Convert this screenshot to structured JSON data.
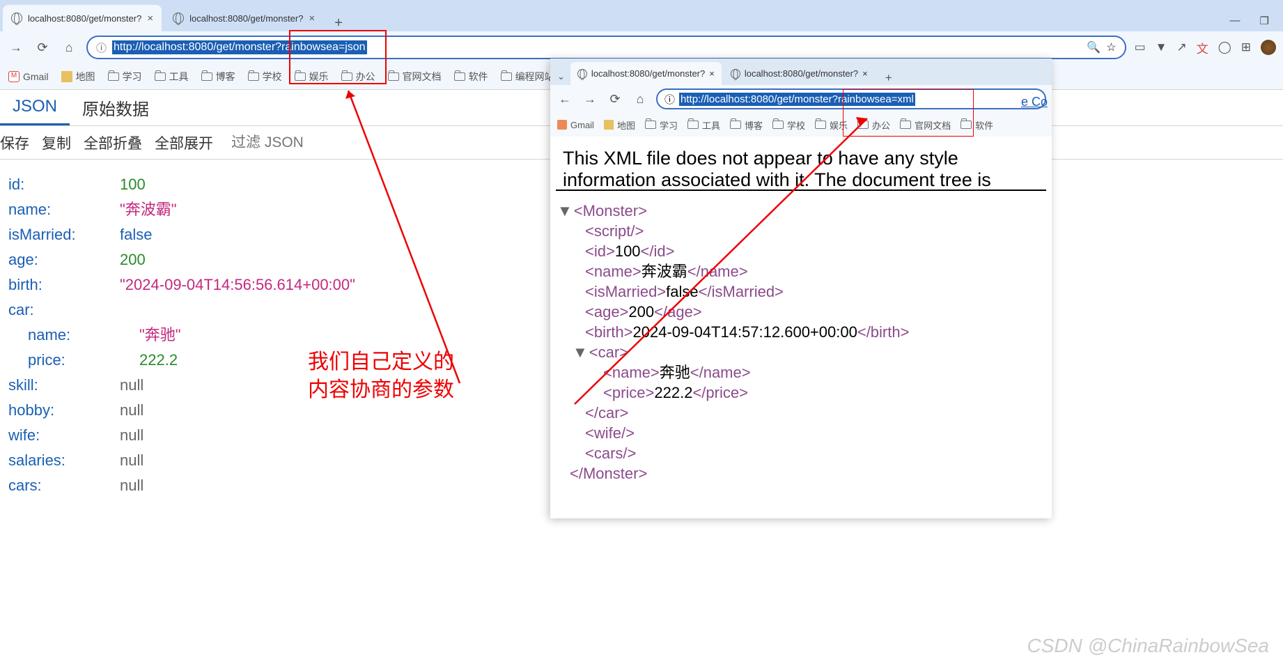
{
  "main_window": {
    "tabs": [
      {
        "title": "localhost:8080/get/monster?"
      },
      {
        "title": "localhost:8080/get/monster?"
      }
    ],
    "url_selected": "http://localhost:8080/get/monster?rainbowsea=json",
    "bookmarks": [
      "Gmail",
      "地图",
      "学习",
      "工具",
      "博客",
      "学校",
      "娱乐",
      "办公",
      "官网文档",
      "软件",
      "编程网站"
    ],
    "json_tab_active": "JSON",
    "json_tab_raw": "原始数据",
    "toolbar": {
      "save": "保存",
      "copy": "复制",
      "collapse": "全部折叠",
      "expand": "全部展开",
      "filter_placeholder": "过滤 JSON"
    },
    "json": {
      "id": "100",
      "name": "\"奔波霸\"",
      "isMarried": "false",
      "age": "200",
      "birth": "\"2024-09-04T14:56:56.614+00:00\"",
      "car_label": "car:",
      "car": {
        "name": "\"奔驰\"",
        "price": "222.2"
      },
      "skill": "null",
      "hobby": "null",
      "wife": "null",
      "salaries": "null",
      "cars": "null"
    }
  },
  "annotation": "我们自己定义的\n内容协商的参数",
  "second_window": {
    "tabs": [
      {
        "title": "localhost:8080/get/monster?"
      },
      {
        "title": "localhost:8080/get/monster?"
      }
    ],
    "url_prefix": "http://localhost:8080/get/monster",
    "url_suffix": "?rainbowsea=xml",
    "bookmarks": [
      "Gmail",
      "地图",
      "学习",
      "工具",
      "博客",
      "学校",
      "娱乐",
      "办公",
      "官网文档",
      "软件"
    ],
    "xml_header": "This XML file does not appear to have any style information associated with it. The document tree is shown below.",
    "xml": {
      "root": "Monster",
      "id": "100",
      "name": "奔波霸",
      "isMarried": "false",
      "age": "200",
      "birth": "2024-09-04T14:57:12.600+00:00",
      "car": {
        "name": "奔驰",
        "price": "222.2"
      }
    },
    "eco_link": "e Co"
  },
  "watermark": "CSDN @ChinaRainbowSea"
}
